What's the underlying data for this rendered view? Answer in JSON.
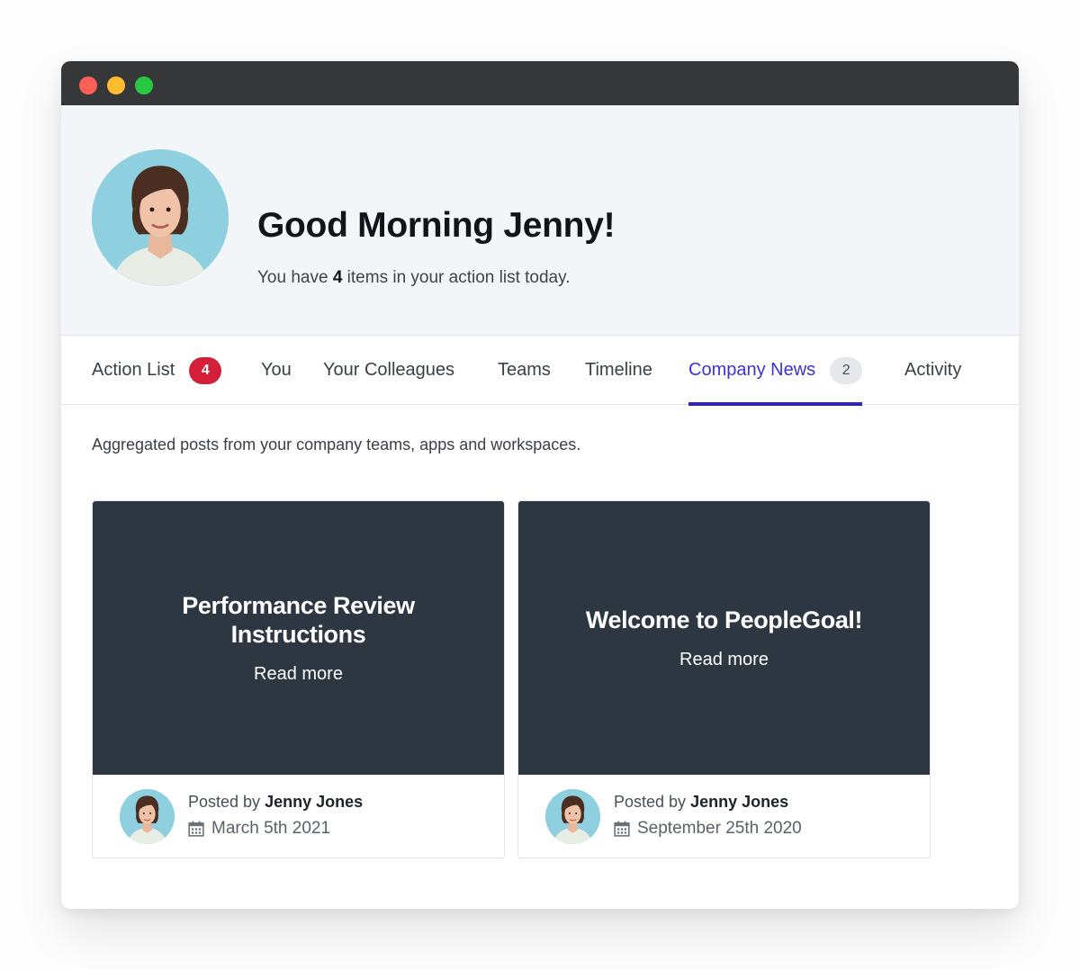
{
  "header": {
    "greeting": "Good Morning Jenny!",
    "sub_prefix": "You have ",
    "sub_count": "4",
    "sub_suffix": " items in your action list today."
  },
  "tabs": [
    {
      "label": "Action List",
      "badge": "4",
      "badge_color": "#d51f39"
    },
    {
      "label": "You"
    },
    {
      "label": "Your Colleagues"
    },
    {
      "label": "Teams"
    },
    {
      "label": "Timeline"
    },
    {
      "label": "Company News",
      "badge": "2",
      "active": true
    },
    {
      "label": "Activity"
    }
  ],
  "intro": "Aggregated posts from your company teams, apps and workspaces.",
  "posts": [
    {
      "title": "Performance Review Instructions",
      "read_more": "Read more",
      "posted_by_label": "Posted by",
      "author": "Jenny Jones",
      "date": "March 5th 2021"
    },
    {
      "title": "Welcome to PeopleGoal!",
      "read_more": "Read more",
      "posted_by_label": "Posted by",
      "author": "Jenny Jones",
      "date": "September 25th 2020"
    }
  ],
  "colors": {
    "accent": "#2d23c8",
    "card_background": "#2d3741",
    "hero_background": "#f3f6f9"
  }
}
